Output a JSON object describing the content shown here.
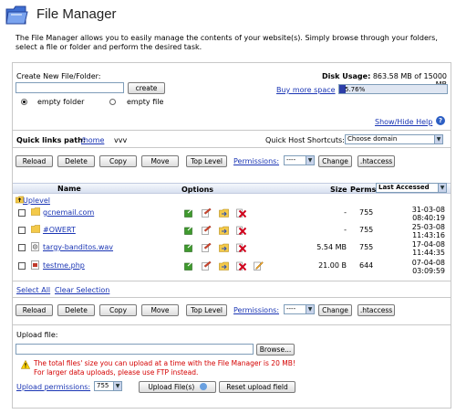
{
  "header": {
    "title": "File Manager",
    "description_line1": "The File Manager allows you to easily manage the contents of your website(s). Simply browse through your folders,",
    "description_line2": "select a file or folder and perform the desired task."
  },
  "create": {
    "label": "Create New File/Folder:",
    "input_value": "",
    "create_button": "create",
    "option_folder": "empty folder",
    "option_file": "empty file",
    "selected": "empty folder"
  },
  "disk": {
    "label": "Disk Usage:",
    "value": "863.58 MB of 15000 MB",
    "buy_link": "Buy more space",
    "percent_text": "5.76%",
    "percent": 5.76
  },
  "help_link": "Show/Hide Help",
  "quicklinks": {
    "label": "Quick links path:",
    "home": "/home",
    "path": "vvv",
    "host_label": "Quick Host Shortcuts:",
    "host_selected": "Choose domain"
  },
  "toolbar": {
    "reload": "Reload",
    "delete": "Delete",
    "copy": "Copy",
    "move": "Move",
    "top_level": "Top Level",
    "permissions_link": "Permissions:",
    "permissions_value": "----",
    "change": "Change",
    "htaccess": ".htaccess"
  },
  "table": {
    "col_name": "Name",
    "col_options": "Options",
    "col_size": "Size",
    "col_perms": "Perms",
    "sort_selected": "Last Accessed",
    "uplevel": "Uplevel",
    "rows": [
      {
        "name": "gcnemail.com",
        "type": "folder",
        "size": "-",
        "perms": "755",
        "date": "31-03-08",
        "time": "08:40:19",
        "edit": false
      },
      {
        "name": "#OWERT",
        "type": "folder",
        "size": "-",
        "perms": "755",
        "date": "25-03-08",
        "time": "11:43:16",
        "edit": false
      },
      {
        "name": "targy-banditos.wav",
        "type": "audio",
        "size": "5.54 MB",
        "perms": "755",
        "date": "17-04-08",
        "time": "11:44:35",
        "edit": false
      },
      {
        "name": "testme.php",
        "type": "php",
        "size": "21.00 B",
        "perms": "644",
        "date": "07-04-08",
        "time": "03:09:59",
        "edit": true
      }
    ]
  },
  "selection": {
    "select_all": "Select All",
    "clear": "Clear Selection"
  },
  "upload": {
    "label": "Upload file:",
    "input_value": "",
    "browse": "Browse...",
    "warning_line1": "The total files' size you can upload at a time with the File Manager is 20 MB!",
    "warning_line2": "For larger data uploads, please use FTP instead.",
    "perm_link": "Upload permissions:",
    "perm_value": "755",
    "upload_button": "Upload File(s)",
    "reset_button": "Reset upload field"
  }
}
